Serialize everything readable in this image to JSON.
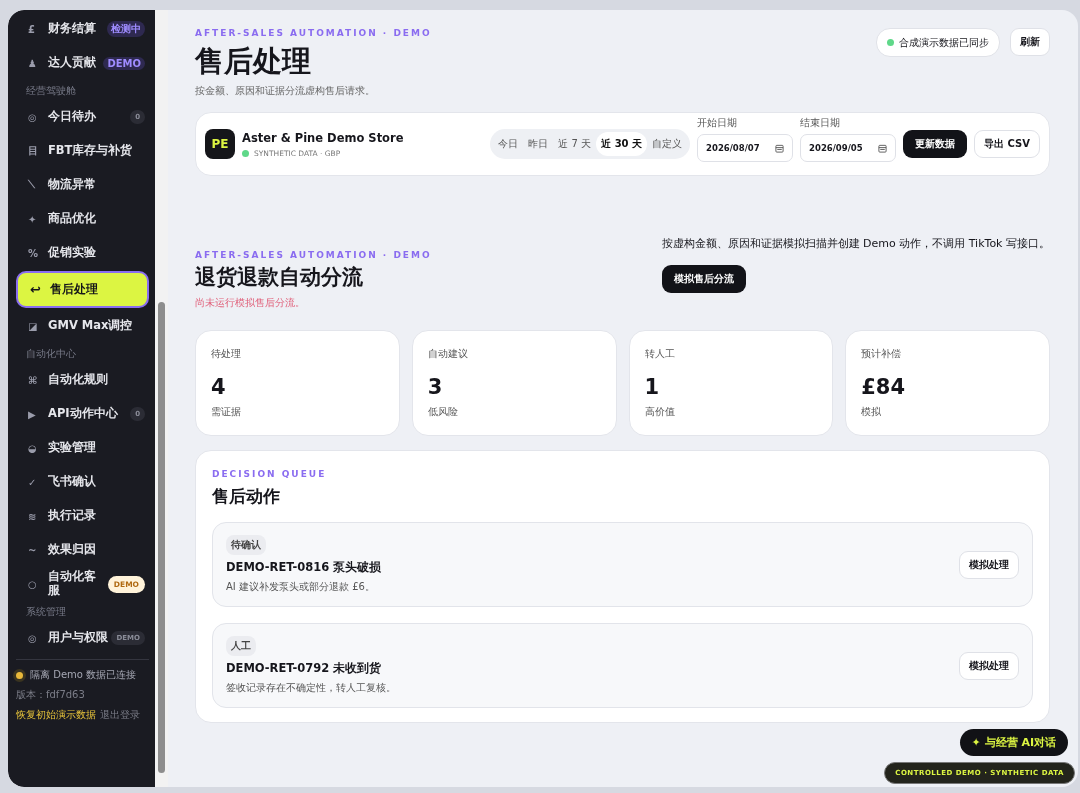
{
  "sidebar": {
    "groups": [
      {
        "items": [
          {
            "icon": "£",
            "label": "财务结算",
            "selected": false,
            "badge": {
              "text": "检测中",
              "kind": "purple"
            }
          },
          {
            "icon": "♟",
            "label": "达人贡献",
            "selected": false,
            "badge": {
              "text": "DEMO",
              "kind": "purple"
            }
          }
        ]
      },
      {
        "title": "经营驾驶舱",
        "items": [
          {
            "icon": "◎",
            "label": "今日待办",
            "selected": false,
            "badge": {
              "text": "0",
              "kind": "dark"
            }
          },
          {
            "icon": "目",
            "label": "FBT库存与补货",
            "selected": false
          },
          {
            "icon": "⟍",
            "label": "物流异常",
            "selected": false
          },
          {
            "icon": "✦",
            "label": "商品优化",
            "selected": false
          },
          {
            "icon": "%",
            "label": "促销实验",
            "selected": false
          },
          {
            "icon": "↩",
            "label": "售后处理",
            "selected": true
          },
          {
            "icon": "◪",
            "label": "GMV Max调控",
            "selected": false
          }
        ]
      },
      {
        "title": "自动化中心",
        "items": [
          {
            "icon": "⌘",
            "label": "自动化规则",
            "selected": false
          },
          {
            "icon": "▶",
            "label": "API动作中心",
            "selected": false,
            "badge": {
              "text": "0",
              "kind": "dark"
            }
          },
          {
            "icon": "◒",
            "label": "实验管理",
            "selected": false
          },
          {
            "icon": "✓",
            "label": "飞书确认",
            "selected": false
          },
          {
            "icon": "≋",
            "label": "执行记录",
            "selected": false
          },
          {
            "icon": "~",
            "label": "效果归因",
            "selected": false
          },
          {
            "icon": "○",
            "label": "自动化客服",
            "selected": false,
            "badge": {
              "text": "DEMO",
              "kind": "cream"
            }
          }
        ]
      },
      {
        "title": "系统管理",
        "items": [
          {
            "icon": "◎",
            "label": "用户与权限",
            "selected": false,
            "badge": {
              "text": "DEMO",
              "kind": "dark"
            }
          }
        ]
      }
    ],
    "status": "隔离 Demo 数据已连接",
    "version": "版本：fdf7d63",
    "restore_link": "恢复初始演示数据",
    "logout_link": "退出登录"
  },
  "header": {
    "eyebrow": "AFTER-SALES AUTOMATION · DEMO",
    "title": "售后处理",
    "subtitle": "按金额、原因和证据分流虚构售后请求。",
    "sync_status": "合成演示数据已同步",
    "refresh_button": "刷新"
  },
  "store_bar": {
    "avatar": "PE",
    "name": "Aster & Pine Demo Store",
    "meta": "SYNTHETIC DATA · GBP",
    "ranges": [
      {
        "label": "今日",
        "selected": false
      },
      {
        "label": "昨日",
        "selected": false
      },
      {
        "label": "近 7 天",
        "selected": false
      },
      {
        "label": "近 30 天",
        "selected": true
      },
      {
        "label": "自定义",
        "selected": false
      }
    ],
    "start_label": "开始日期",
    "start_date": "2026/08/07",
    "end_label": "结束日期",
    "end_date": "2026/09/05",
    "update_button": "更新数据",
    "export_button": "导出 CSV"
  },
  "section": {
    "eyebrow": "AFTER-SALES AUTOMATION · DEMO",
    "title": "退货退款自动分流",
    "notice": "尚未运行模拟售后分流。",
    "description": "按虚构金额、原因和证据模拟扫描并创建 Demo 动作，不调用 TikTok 写接口。",
    "run_button": "模拟售后分流"
  },
  "stats": [
    {
      "label": "待处理",
      "value": "4",
      "note": "需证据"
    },
    {
      "label": "自动建议",
      "value": "3",
      "note": "低风险"
    },
    {
      "label": "转人工",
      "value": "1",
      "note": "高价值"
    },
    {
      "label": "预计补偿",
      "value": "£84",
      "note": "模拟"
    }
  ],
  "queue": {
    "eyebrow": "DECISION QUEUE",
    "title": "售后动作",
    "items": [
      {
        "tag": "待确认",
        "title": "DEMO-RET-0816 泵头破损",
        "detail": "AI 建议补发泵头或部分退款 £6。",
        "button": "模拟处理"
      },
      {
        "tag": "人工",
        "title": "DEMO-RET-0792 未收到货",
        "detail": "签收记录存在不确定性，转人工复核。",
        "button": "模拟处理"
      }
    ]
  },
  "chat_button": "✦ 与经营 AI对话",
  "demo_badge": "CONTROLLED DEMO · SYNTHETIC DATA"
}
